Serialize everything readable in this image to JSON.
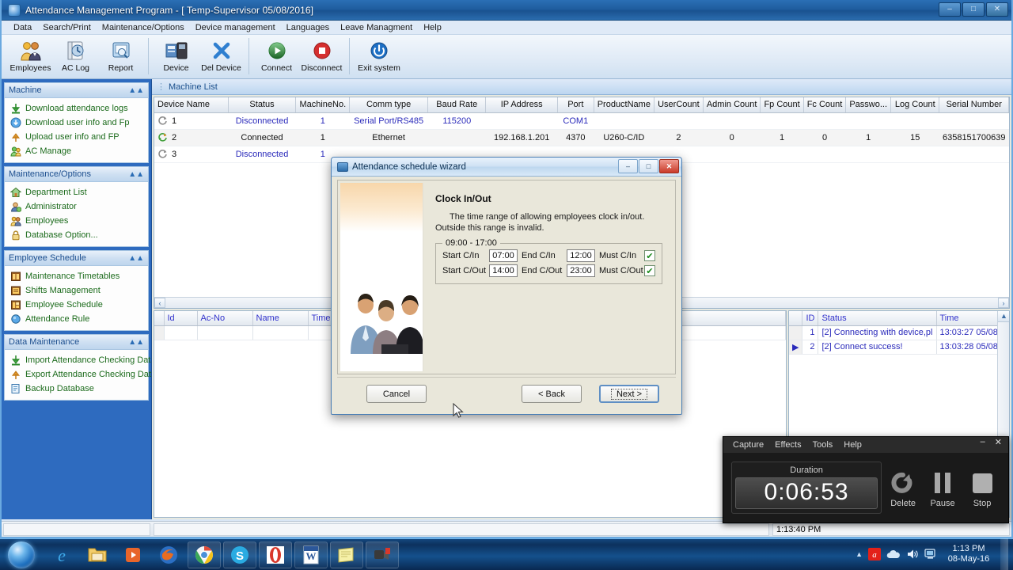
{
  "window": {
    "title": "Attendance Management Program - [ Temp-Supervisor 05/08/2016]",
    "icon": "app-icon",
    "minimize": "–",
    "maximize": "□",
    "close": "✕"
  },
  "menubar": {
    "items": [
      {
        "label": "Data"
      },
      {
        "label": "Search/Print"
      },
      {
        "label": "Maintenance/Options"
      },
      {
        "label": "Device management"
      },
      {
        "label": "Languages"
      },
      {
        "label": "Leave Managment"
      },
      {
        "label": "Help"
      }
    ]
  },
  "toolbar": {
    "group1": [
      {
        "label": "Employees",
        "icon": "employees-icon"
      },
      {
        "label": "AC Log",
        "icon": "aclog-icon"
      },
      {
        "label": "Report",
        "icon": "report-icon"
      }
    ],
    "group2": [
      {
        "label": "Device",
        "icon": "device-icon"
      },
      {
        "label": "Del Device",
        "icon": "del-device-icon"
      }
    ],
    "group3": [
      {
        "label": "Connect",
        "icon": "connect-icon"
      },
      {
        "label": "Disconnect",
        "icon": "disconnect-icon"
      }
    ],
    "group4": [
      {
        "label": "Exit system",
        "icon": "exit-icon"
      }
    ]
  },
  "sidebar": {
    "panels": [
      {
        "title": "Machine",
        "collapse_icon": "chevron-up-icon",
        "items": [
          {
            "label": "Download attendance logs",
            "icon": "download-green-icon"
          },
          {
            "label": "Download user info and Fp",
            "icon": "download-blue-icon"
          },
          {
            "label": "Upload user info and FP",
            "icon": "upload-orange-icon"
          },
          {
            "label": "AC Manage",
            "icon": "users-icon"
          }
        ]
      },
      {
        "title": "Maintenance/Options",
        "collapse_icon": "chevron-up-icon",
        "items": [
          {
            "label": "Department List",
            "icon": "department-icon"
          },
          {
            "label": "Administrator",
            "icon": "administrator-icon"
          },
          {
            "label": "Employees",
            "icon": "employees-icon"
          },
          {
            "label": "Database Option...",
            "icon": "lock-icon"
          }
        ]
      },
      {
        "title": "Employee Schedule",
        "collapse_icon": "chevron-up-icon",
        "items": [
          {
            "label": "Maintenance Timetables",
            "icon": "timetable-icon"
          },
          {
            "label": "Shifts Management",
            "icon": "shifts-icon"
          },
          {
            "label": "Employee Schedule",
            "icon": "schedule-icon"
          },
          {
            "label": "Attendance Rule",
            "icon": "rule-icon"
          }
        ]
      },
      {
        "title": "Data Maintenance",
        "collapse_icon": "chevron-up-icon",
        "items": [
          {
            "label": "Import Attendance Checking Data",
            "icon": "import-icon"
          },
          {
            "label": "Export Attendance Checking Data",
            "icon": "export-icon"
          },
          {
            "label": "Backup Database",
            "icon": "backup-icon"
          }
        ]
      }
    ]
  },
  "machine_list": {
    "tab_label": "Machine List",
    "columns": [
      "Device Name",
      "Status",
      "MachineNo.",
      "Comm type",
      "Baud Rate",
      "IP Address",
      "Port",
      "ProductName",
      "UserCount",
      "Admin Count",
      "Fp Count",
      "Fc Count",
      "Passwo...",
      "Log Count",
      "Serial Number"
    ],
    "rows": [
      {
        "device_name": "1",
        "status": "Disconnected",
        "machine_no": "1",
        "comm_type": "Serial Port/RS485",
        "baud_rate": "115200",
        "ip_address": "",
        "port": "COM1",
        "product_name": "",
        "user_count": "",
        "admin_count": "",
        "fp_count": "",
        "fc_count": "",
        "password": "",
        "log_count": "",
        "serial_number": "",
        "icon": "refresh-grey-icon"
      },
      {
        "device_name": "2",
        "status": "Connected",
        "machine_no": "1",
        "comm_type": "Ethernet",
        "baud_rate": "",
        "ip_address": "192.168.1.201",
        "port": "4370",
        "product_name": "U260-C/ID",
        "user_count": "2",
        "admin_count": "0",
        "fp_count": "1",
        "fc_count": "0",
        "password": "1",
        "log_count": "15",
        "serial_number": "6358151700639",
        "icon": "refresh-green-icon"
      },
      {
        "device_name": "3",
        "status": "Disconnected",
        "machine_no": "1",
        "comm_type": "",
        "baud_rate": "",
        "ip_address": "",
        "port": "",
        "product_name": "",
        "user_count": "",
        "admin_count": "",
        "fp_count": "",
        "fc_count": "",
        "password": "",
        "log_count": "",
        "serial_number": "",
        "icon": "refresh-grey-icon"
      }
    ],
    "scroll_left": "‹",
    "scroll_right": "›"
  },
  "record_grid": {
    "columns": [
      "Id",
      "Ac-No",
      "Name",
      "Time"
    ],
    "rows": [],
    "scroll_left": "‹",
    "scroll_right": "›"
  },
  "log_grid": {
    "columns": [
      "ID",
      "Status",
      "Time"
    ],
    "rows": [
      {
        "marker": "",
        "id": "1",
        "status": "[2] Connecting with device,pl",
        "time": "13:03:27 05/08/"
      },
      {
        "marker": "▶",
        "id": "2",
        "status": "[2] Connect success!",
        "time": "13:03:28 05/08/"
      }
    ],
    "scroll_up": "▲",
    "scroll_down": "▼"
  },
  "statusbar": {
    "left": "",
    "middle": "",
    "time": "1:13:40 PM"
  },
  "dialog": {
    "title": "Attendance schedule wizard",
    "icon": "wizard-icon",
    "minimize": "–",
    "maximize": "□",
    "close": "✕",
    "heading": "Clock In/Out",
    "body_line1": "The time range of allowing employees clock in/out.",
    "body_line2": "Outside this range is invalid.",
    "group_legend": "09:00 - 17:00",
    "fields": {
      "start_cin_label": "Start C/In",
      "start_cin_value": "07:00",
      "end_cin_label": "End C/In",
      "end_cin_value": "12:00",
      "must_cin_label": "Must C/In",
      "must_cin_checked": "✔",
      "start_cout_label": "Start C/Out",
      "start_cout_value": "14:00",
      "end_cout_label": "End C/Out",
      "end_cout_value": "23:00",
      "must_cout_label": "Must C/Out",
      "must_cout_checked": "✔"
    },
    "buttons": {
      "cancel": "Cancel",
      "back": "< Back",
      "next": "Next >"
    }
  },
  "capture_widget": {
    "menu": [
      {
        "label": "Capture"
      },
      {
        "label": "Effects"
      },
      {
        "label": "Tools"
      },
      {
        "label": "Help"
      }
    ],
    "minimize": "–",
    "close": "✕",
    "duration_label": "Duration",
    "duration_value": "0:06:53",
    "actions": [
      {
        "label": "Delete",
        "icon": "delete-icon"
      },
      {
        "label": "Pause",
        "icon": "pause-icon"
      },
      {
        "label": "Stop",
        "icon": "stop-icon"
      }
    ]
  },
  "taskbar": {
    "start_label": "start-orb",
    "apps": [
      {
        "name": "internet-explorer-icon"
      },
      {
        "name": "explorer-icon"
      },
      {
        "name": "media-player-icon"
      },
      {
        "name": "firefox-icon"
      },
      {
        "name": "chrome-icon"
      },
      {
        "name": "skype-icon"
      },
      {
        "name": "opera-icon"
      },
      {
        "name": "word-icon"
      },
      {
        "name": "notepad-icon"
      },
      {
        "name": "camtasia-icon"
      }
    ],
    "tray": {
      "show_hidden": "▲",
      "icons": [
        {
          "name": "avira-icon"
        },
        {
          "name": "onedrive-icon"
        },
        {
          "name": "volume-icon"
        },
        {
          "name": "network-icon"
        }
      ],
      "time": "1:13 PM",
      "date": "08-May-16"
    }
  },
  "colors": {
    "title_blue": "#1f5d9f",
    "sidebar_blue": "#2e6bbf",
    "link_green": "#1c6b1c",
    "grid_value_blue": "#2b2bbb",
    "dialog_face": "#e9e7da",
    "accent": "#3d6ea5"
  }
}
